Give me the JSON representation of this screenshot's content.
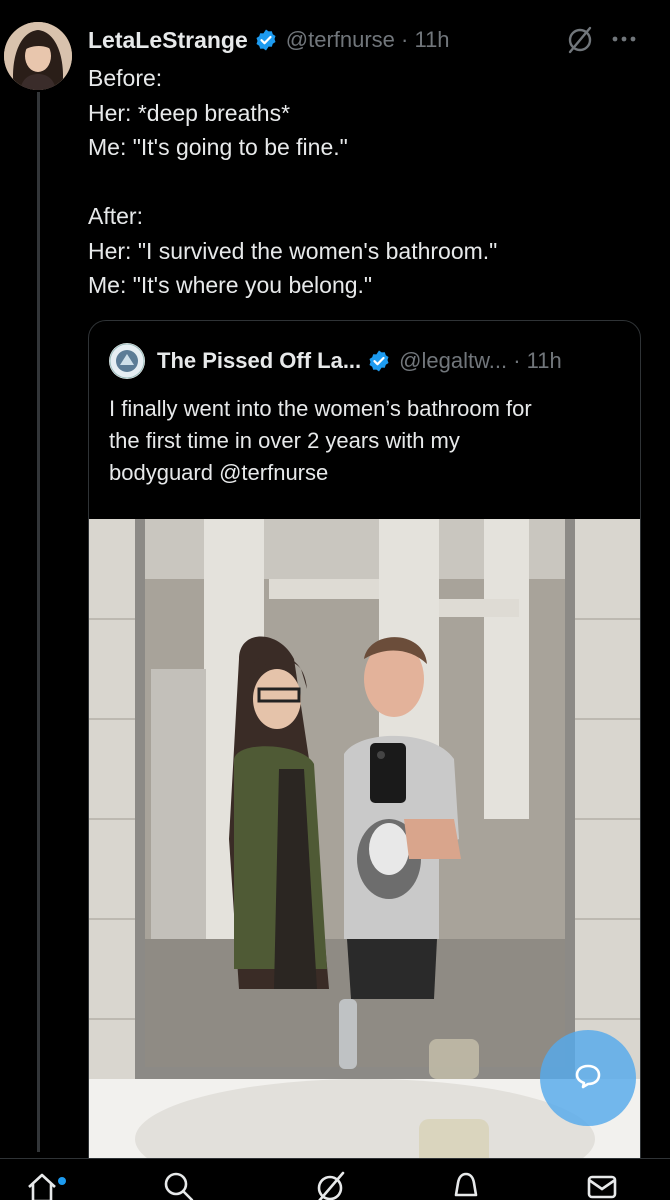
{
  "tweet": {
    "author": {
      "display_name": "LetaLeStrange",
      "handle_time": "@terfnurse · 11h",
      "verified": true
    },
    "text_lines": [
      "Before:",
      "Her: *deep breaths*",
      "Me: \"It's going to be fine.\"",
      "",
      "After:",
      "Her: \"I survived the women's bathroom.\"",
      "Me: \"It's where you belong.\""
    ]
  },
  "quote": {
    "author": {
      "display_name": "The Pissed Off La...",
      "handle_time": "@legaltw... · 11h",
      "verified": true
    },
    "text_lines": [
      "I finally went into the women’s bathroom for",
      "the first time in over 2 years with my",
      "bodyguard @terfnurse"
    ]
  },
  "icons": {
    "grok": "grok-icon",
    "more": "more-icon",
    "verified": "verified-badge-icon",
    "compose": "reply-fab-icon",
    "nav": [
      "home-icon",
      "search-icon",
      "grok-icon",
      "notifications-icon",
      "messages-icon"
    ]
  },
  "colors": {
    "background": "#000000",
    "text": "#e7e9ea",
    "muted": "#71767b",
    "accent": "#1d9bf0",
    "border": "#2f3336"
  }
}
